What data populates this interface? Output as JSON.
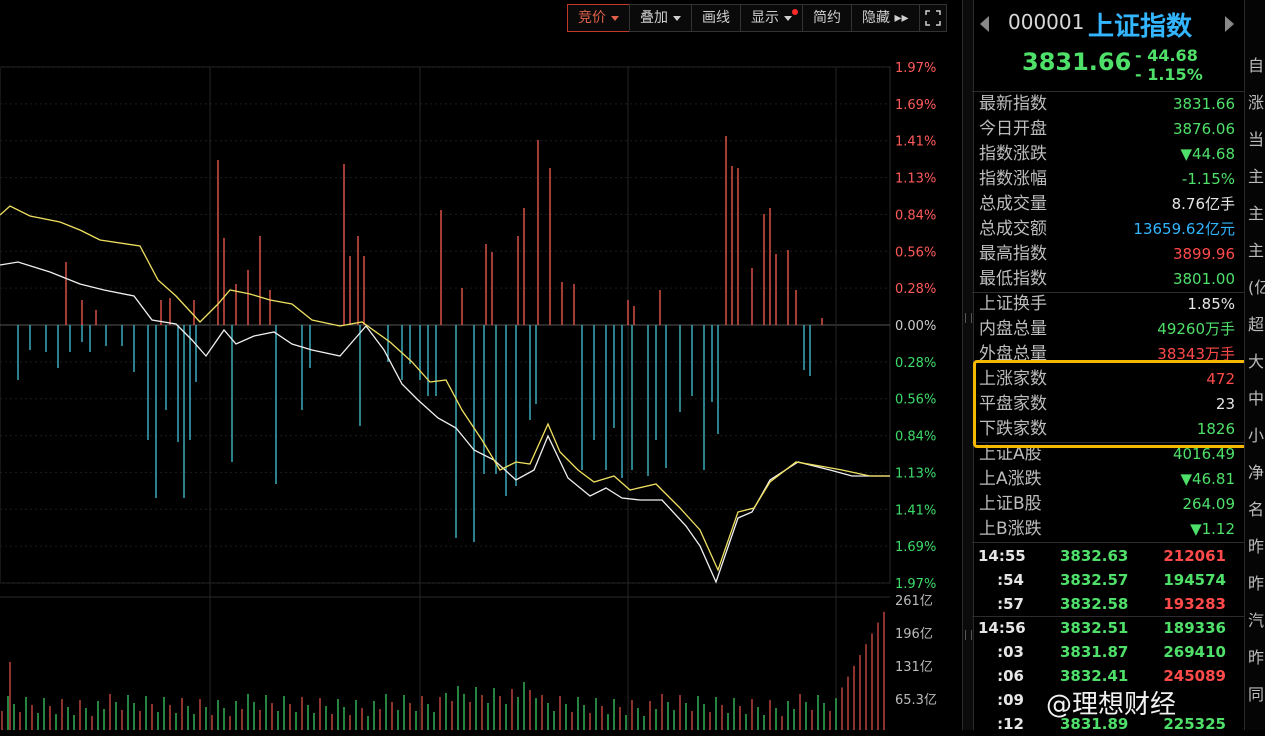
{
  "toolbar": [
    {
      "label": "竞价",
      "dropdown": true,
      "active": true
    },
    {
      "label": "叠加",
      "dropdown": true
    },
    {
      "label": "画线"
    },
    {
      "label": "显示",
      "dropdown": true,
      "dot": true
    },
    {
      "label": "简约"
    },
    {
      "label": "隐藏 ▸▸"
    }
  ],
  "chart": {
    "right_axis": [
      "1.97%",
      "1.69%",
      "1.41%",
      "1.13%",
      "0.84%",
      "0.56%",
      "0.28%",
      "0.00%",
      "0.28%",
      "0.56%",
      "0.84%",
      "1.13%",
      "1.41%",
      "1.69%",
      "1.97%"
    ],
    "volume_axis": [
      "261亿",
      "196亿",
      "131亿",
      "65.3亿"
    ]
  },
  "quote": {
    "code": "000001",
    "name": "上证指数",
    "price": "3831.66",
    "change": "- 44.68",
    "change_pct": "- 1.15%"
  },
  "stats": [
    {
      "label": "最新指数",
      "value": "3831.66",
      "color": "dn"
    },
    {
      "label": "今日开盘",
      "value": "3876.06",
      "color": "dn"
    },
    {
      "label": "指数涨跌",
      "value": "▼44.68",
      "color": "dn"
    },
    {
      "label": "指数涨幅",
      "value": "-1.15%",
      "color": "dn"
    },
    {
      "label": "总成交量",
      "value": "8.76亿手",
      "color": "wh"
    },
    {
      "label": "总成交额",
      "value": "13659.62亿元",
      "color": "cy"
    },
    {
      "label": "最高指数",
      "value": "3899.96",
      "color": "up"
    },
    {
      "label": "最低指数",
      "value": "3801.00",
      "color": "dn"
    },
    {
      "label": "上证换手",
      "value": "1.85%",
      "color": "wh"
    },
    {
      "label": "内盘总量",
      "value": "49260万手",
      "color": "dn"
    },
    {
      "label": "外盘总量",
      "value": "38343万手",
      "color": "up"
    },
    {
      "label": "上涨家数",
      "value": "472",
      "color": "up"
    },
    {
      "label": "平盘家数",
      "value": "23",
      "color": "wh"
    },
    {
      "label": "下跌家数",
      "value": "1826",
      "color": "dn"
    },
    {
      "label": "上证A股",
      "value": "4016.49",
      "color": "dn"
    },
    {
      "label": "上A涨跌",
      "value": "▼46.81",
      "color": "dn"
    },
    {
      "label": "上证B股",
      "value": "264.09",
      "color": "dn"
    },
    {
      "label": "上B涨跌",
      "value": "▼1.12",
      "color": "dn"
    }
  ],
  "ticks": [
    {
      "time": "14:55",
      "price": "3832.63",
      "vol": "212061",
      "vc": "up"
    },
    {
      "time": ":54",
      "price": "3832.57",
      "vol": "194574",
      "vc": "dn"
    },
    {
      "time": ":57",
      "price": "3832.58",
      "vol": "193283",
      "vc": "up"
    },
    {
      "time": "14:56",
      "price": "3832.51",
      "vol": "189336",
      "vc": "dn"
    },
    {
      "time": ":03",
      "price": "3831.87",
      "vol": "269410",
      "vc": "dn"
    },
    {
      "time": ":06",
      "price": "3832.41",
      "vol": "245089",
      "vc": "up"
    },
    {
      "time": ":09",
      "price": "",
      "vol": "",
      "vc": "up"
    },
    {
      "time": ":12",
      "price": "3831.89",
      "vol": "225325",
      "vc": "dn"
    }
  ],
  "strip": [
    "自",
    "涨",
    "当",
    "主",
    "主",
    "主",
    "(亿",
    "超",
    "大",
    "中",
    "小",
    "净",
    "名",
    "昨",
    "昨",
    "汽",
    "昨",
    "同"
  ],
  "watermark": "@理想财经"
}
